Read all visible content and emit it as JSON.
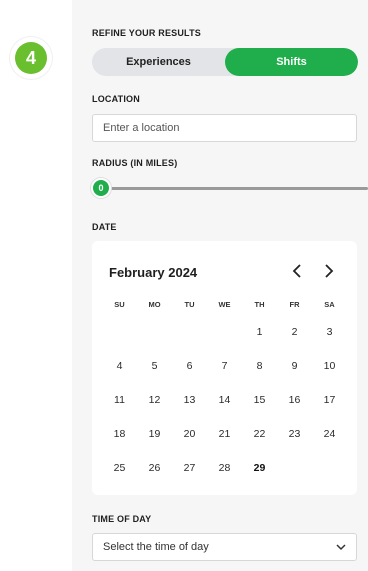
{
  "step": {
    "number": "4"
  },
  "refine": {
    "title": "REFINE YOUR RESULTS",
    "options": [
      {
        "label": "Experiences",
        "active": false
      },
      {
        "label": "Shifts",
        "active": true
      }
    ]
  },
  "location": {
    "label": "LOCATION",
    "placeholder": "Enter a location",
    "value": ""
  },
  "radius": {
    "label": "RADIUS (IN MILES)",
    "value": "0"
  },
  "date": {
    "label": "DATE",
    "month": "February 2024",
    "weekdays": [
      "SU",
      "MO",
      "TU",
      "WE",
      "TH",
      "FR",
      "SA"
    ],
    "weeks": [
      [
        "",
        "",
        "",
        "",
        "1",
        "2",
        "3"
      ],
      [
        "4",
        "5",
        "6",
        "7",
        "8",
        "9",
        "10"
      ],
      [
        "11",
        "12",
        "13",
        "14",
        "15",
        "16",
        "17"
      ],
      [
        "18",
        "19",
        "20",
        "21",
        "22",
        "23",
        "24"
      ],
      [
        "25",
        "26",
        "27",
        "28",
        "29",
        "",
        ""
      ]
    ],
    "today": "29"
  },
  "time_of_day": {
    "label": "TIME OF DAY",
    "selected": "Select the time of day"
  },
  "colors": {
    "accent_green": "#1fae4b",
    "badge_green": "#6abf2e"
  }
}
